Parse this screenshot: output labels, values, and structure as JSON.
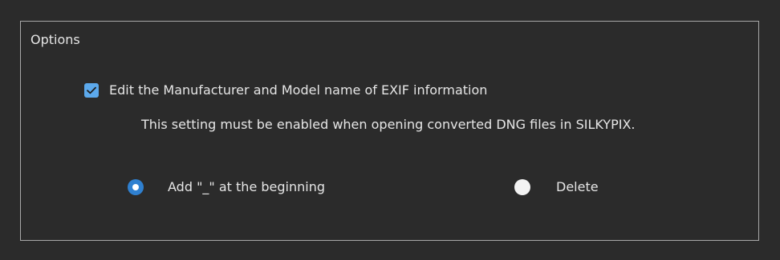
{
  "options": {
    "title": "Options",
    "edit_exif": {
      "label": "Edit the Manufacturer and Model name of EXIF information",
      "checked": true,
      "note": "This setting must be enabled when opening converted DNG files in SILKYPIX."
    },
    "rename_mode": {
      "selected": "add_underscore",
      "choices": [
        {
          "id": "add_underscore",
          "label": "Add \"_\" at the beginning"
        },
        {
          "id": "delete",
          "label": "Delete"
        }
      ]
    }
  },
  "colors": {
    "background": "#2b2b2b",
    "panel_border": "#a8a8a8",
    "text": "#e6e6e6",
    "checkbox_fill": "#5ca9ec",
    "radio_selected": "#2f80d0",
    "radio_unselected": "#f3f3f3"
  }
}
